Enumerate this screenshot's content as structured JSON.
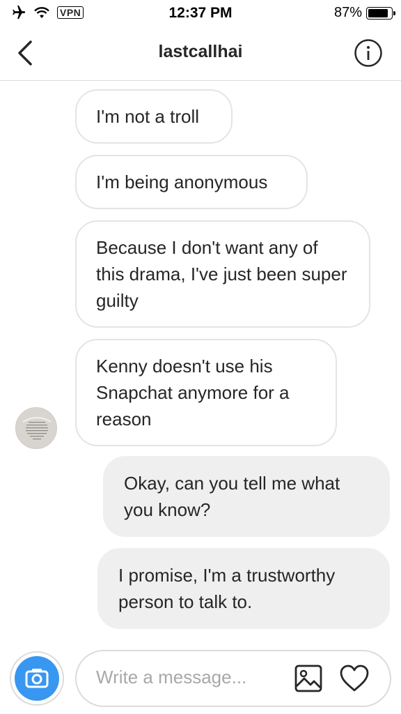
{
  "status_bar": {
    "vpn": "VPN",
    "time": "12:37 PM",
    "battery": "87%",
    "battery_level": 0.87
  },
  "header": {
    "title": "lastcallhai"
  },
  "messages": [
    {
      "direction": "incoming",
      "text": "I'm not a troll"
    },
    {
      "direction": "incoming",
      "text": "I'm being anonymous"
    },
    {
      "direction": "incoming",
      "text": "Because I don't want any of this drama, I've just been super guilty"
    },
    {
      "direction": "incoming",
      "text": "Kenny doesn't use his Snapchat anymore for a reason"
    },
    {
      "direction": "outgoing",
      "text": "Okay, can you tell me what you know?"
    },
    {
      "direction": "outgoing",
      "text": "I promise, I'm a trustworthy person to talk to."
    }
  ],
  "composer": {
    "placeholder": "Write a message...",
    "accent_color": "#3897f0"
  },
  "icons": {
    "back": "chevron-left-icon",
    "info": "info-icon",
    "camera": "camera-icon",
    "gallery": "image-icon",
    "like": "heart-icon"
  }
}
